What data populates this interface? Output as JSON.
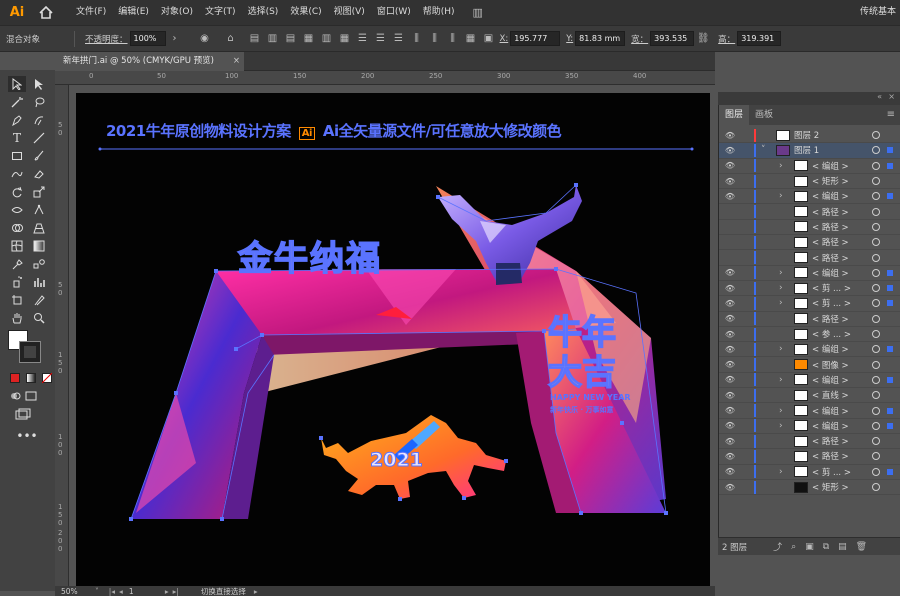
{
  "app": {
    "logo": "Ai",
    "workspace": "传统基本"
  },
  "menu": [
    "文件(F)",
    "编辑(E)",
    "对象(O)",
    "文字(T)",
    "选择(S)",
    "效果(C)",
    "视图(V)",
    "窗口(W)",
    "帮助(H)"
  ],
  "layout_switch": "▥",
  "control": {
    "object_type": "混合对象",
    "opacity_label": "不透明度：",
    "opacity_value": "100%",
    "x_label": "X:",
    "x_value": "195.777",
    "y_label": "Y:",
    "y_value": "81.83 mm",
    "w_label": "宽：",
    "w_value": "393.535",
    "h_label": "高：",
    "h_value": "319.391"
  },
  "document": {
    "tab_title": "新年拱门.ai @ 50% (CMYK/GPU 预览)",
    "close": "×"
  },
  "ruler": {
    "top": [
      "0",
      "50",
      "100",
      "150",
      "200",
      "250",
      "300",
      "350",
      "400"
    ],
    "left": [
      "5",
      "0",
      "5",
      "0",
      "1",
      "5",
      "0",
      "1",
      "0",
      "0",
      "1",
      "5",
      "0",
      "2",
      "0",
      "0"
    ]
  },
  "artwork": {
    "headline_pre": "2021牛年原创物料设计方案",
    "headline_ai": "Ai",
    "headline_post": "Ai全矢量源文件/可任意放大修改颜色",
    "title_main": "金牛纳福",
    "title_side_1": "牛年",
    "title_side_2": "大吉",
    "sub_en": "HAPPY NEW YEAR",
    "sub_cn": "新年快乐 · 万事如意",
    "year": "2021"
  },
  "layers_panel": {
    "tabs": [
      "图层",
      "画板"
    ],
    "menu_icon": "≡",
    "rows": [
      {
        "name": "图层 2",
        "color": "#ff3a3a",
        "eye": "visible",
        "expand": ""
      },
      {
        "name": "图层 1",
        "color": "#3c6ef0",
        "eye": "visible",
        "expand": "˅"
      },
      {
        "name": "< 编组 >",
        "color": "#3c6ef0",
        "eye": "visible",
        "expand": "›"
      },
      {
        "name": "< 矩形 >",
        "color": "#3c6ef0",
        "eye": "visible",
        "expand": ""
      },
      {
        "name": "< 编组 >",
        "color": "#3c6ef0",
        "eye": "visible",
        "expand": "›"
      },
      {
        "name": "< 路径 >",
        "color": "#3c6ef0",
        "eye": "",
        "expand": ""
      },
      {
        "name": "< 路径 >",
        "color": "#3c6ef0",
        "eye": "",
        "expand": ""
      },
      {
        "name": "< 路径 >",
        "color": "#3c6ef0",
        "eye": "",
        "expand": ""
      },
      {
        "name": "< 路径 >",
        "color": "#3c6ef0",
        "eye": "",
        "expand": ""
      },
      {
        "name": "< 编组 >",
        "color": "#3c6ef0",
        "eye": "visible",
        "expand": "›"
      },
      {
        "name": "< 剪 ... >",
        "color": "#3c6ef0",
        "eye": "visible",
        "expand": "›"
      },
      {
        "name": "< 剪 ... >",
        "color": "#3c6ef0",
        "eye": "visible",
        "expand": "›"
      },
      {
        "name": "< 路径 >",
        "color": "#3c6ef0",
        "eye": "visible",
        "expand": ""
      },
      {
        "name": "< 参 ... >",
        "color": "#3c6ef0",
        "eye": "visible",
        "expand": ""
      },
      {
        "name": "< 编组 >",
        "color": "#3c6ef0",
        "eye": "visible",
        "expand": "›"
      },
      {
        "name": "< 图像 >",
        "color": "#3c6ef0",
        "eye": "visible",
        "expand": ""
      },
      {
        "name": "< 编组 >",
        "color": "#3c6ef0",
        "eye": "visible",
        "expand": "›"
      },
      {
        "name": "< 直线 >",
        "color": "#3c6ef0",
        "eye": "visible",
        "expand": ""
      },
      {
        "name": "< 编组 >",
        "color": "#3c6ef0",
        "eye": "visible",
        "expand": "›"
      },
      {
        "name": "< 编组 >",
        "color": "#3c6ef0",
        "eye": "visible",
        "expand": "›"
      },
      {
        "name": "< 路径 >",
        "color": "#3c6ef0",
        "eye": "visible",
        "expand": ""
      },
      {
        "name": "< 路径 >",
        "color": "#3c6ef0",
        "eye": "visible",
        "expand": ""
      },
      {
        "name": "< 剪 ... >",
        "color": "#3c6ef0",
        "eye": "visible",
        "expand": "›"
      },
      {
        "name": "< 矩形 >",
        "color": "#3c6ef0",
        "eye": "visible",
        "expand": ""
      }
    ],
    "count": "2 图层"
  },
  "status": {
    "zoom": "50%",
    "page": "1",
    "tool_hint": "切换直接选择"
  }
}
